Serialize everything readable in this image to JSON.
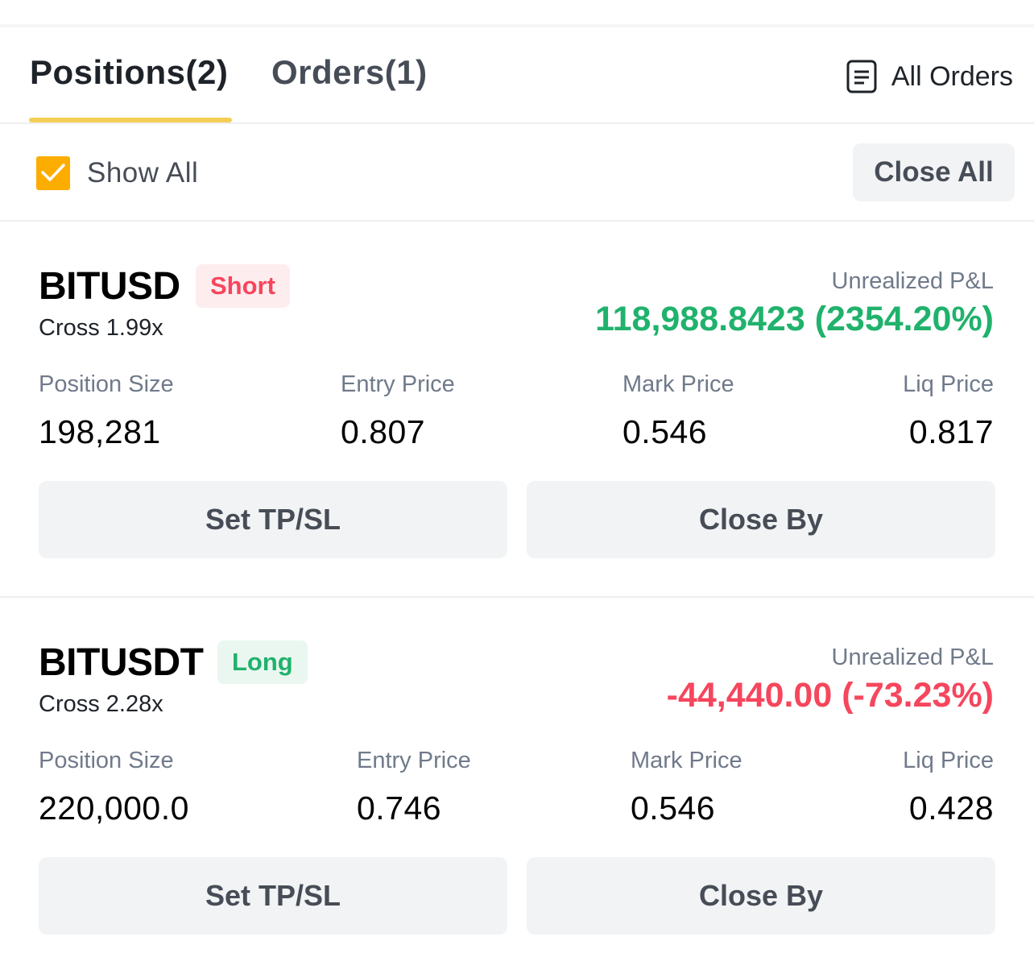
{
  "tabs": [
    {
      "label": "Positions(2)",
      "active": true
    },
    {
      "label": "Orders(1)",
      "active": false
    }
  ],
  "all_orders": {
    "label": "All Orders",
    "icon": "document-list-icon"
  },
  "filter": {
    "show_all_label": "Show All",
    "show_all_checked": true,
    "close_all_label": "Close All"
  },
  "colors": {
    "accent": "#f0b90b",
    "checkbox": "#fcad00",
    "positive": "#20b26c",
    "negative": "#f6465d",
    "liq": "#e8a617",
    "muted": "#707a8a"
  },
  "positions": [
    {
      "symbol": "BITUSD",
      "side": "Short",
      "leverage": "Cross 1.99x",
      "pnl_label": "Unrealized P&L",
      "pnl_value": "118,988.8423 (2354.20%)",
      "columns": {
        "size_label": "Position Size",
        "size_value": "198,281",
        "entry_label": "Entry Price",
        "entry_value": "0.807",
        "mark_label": "Mark Price",
        "mark_value": "0.546",
        "liq_label": "Liq Price",
        "liq_value": "0.817"
      },
      "buttons": {
        "tpsl": "Set TP/SL",
        "close_by": "Close By"
      }
    },
    {
      "symbol": "BITUSDT",
      "side": "Long",
      "leverage": "Cross 2.28x",
      "pnl_label": "Unrealized P&L",
      "pnl_value": "-44,440.00 (-73.23%)",
      "columns": {
        "size_label": "Position Size",
        "size_value": "220,000.0",
        "entry_label": "Entry Price",
        "entry_value": "0.746",
        "mark_label": "Mark Price",
        "mark_value": "0.546",
        "liq_label": "Liq Price",
        "liq_value": "0.428"
      },
      "buttons": {
        "tpsl": "Set TP/SL",
        "close_by": "Close By"
      }
    }
  ]
}
